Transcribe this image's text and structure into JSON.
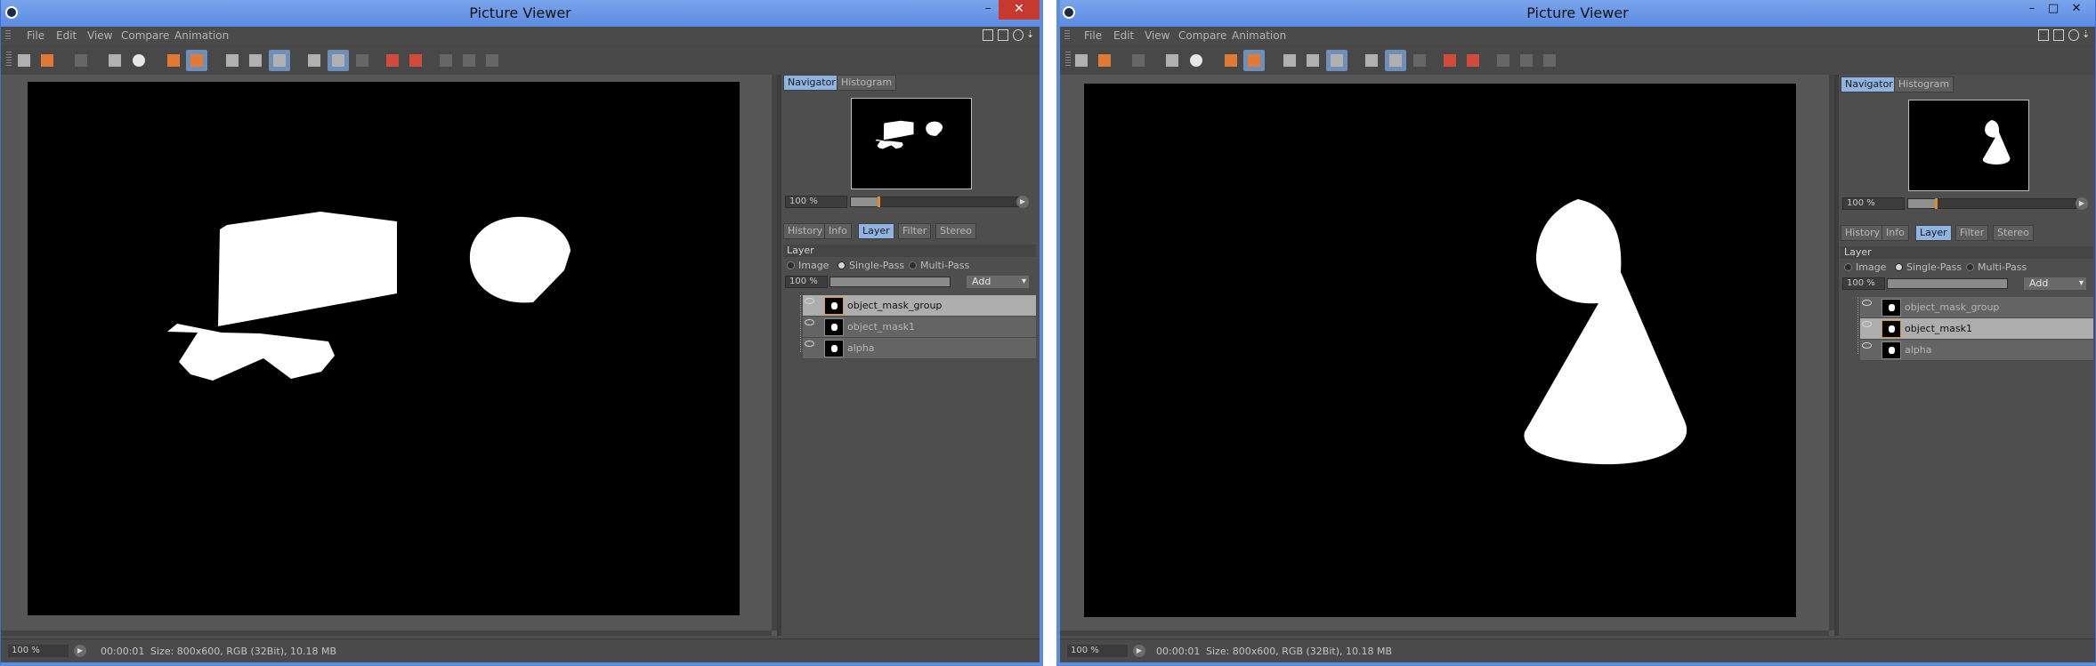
{
  "app": {
    "title": "Picture Viewer"
  },
  "window_controls": {
    "minimize": "–",
    "maximize": "□",
    "close": "✕"
  },
  "menu": [
    "File",
    "Edit",
    "View",
    "Compare",
    "Animation"
  ],
  "panel": {
    "top_tabs": [
      "Navigator",
      "Histogram"
    ],
    "zoom": "100 %",
    "bottom_tabs": [
      "History",
      "Info",
      "Layer",
      "Filter",
      "Stereo"
    ],
    "layer_section": "Layer",
    "modes": [
      "Image",
      "Single-Pass",
      "Multi-Pass"
    ],
    "selected_mode": "Single-Pass",
    "opacity": "100 %",
    "add_label": "Add"
  },
  "windows": [
    {
      "selected_layer": "object_mask_group",
      "layers": [
        "object_mask_group",
        "object_mask1",
        "alpha"
      ],
      "status": {
        "zoom": "100 %",
        "timecode": "00:00:01",
        "info": "Size: 800x600, RGB (32Bit), 10.18 MB"
      }
    },
    {
      "selected_layer": "object_mask1",
      "layers": [
        "object_mask_group",
        "object_mask1",
        "alpha"
      ],
      "status": {
        "zoom": "100 %",
        "timecode": "00:00:01",
        "info": "Size: 800x600, RGB (32Bit), 10.18 MB"
      }
    }
  ],
  "colors": {
    "selection": "#adadad",
    "active_tab": "#8fb4e2",
    "accent": "#e08b2a",
    "title_bar": "#6b98e8",
    "close": "#c7392f"
  }
}
